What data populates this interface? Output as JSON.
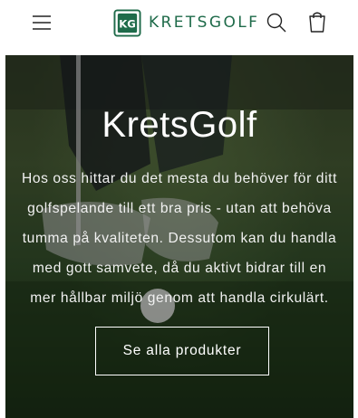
{
  "header": {
    "logo_text": "KRETSGOLF",
    "icons": [
      "menu-icon",
      "search-icon",
      "cart-icon"
    ],
    "brand_color": "#1f6b4a"
  },
  "hero": {
    "title": "KretsGolf",
    "text": "Hos oss hittar du det mesta du behöver för ditt golfspelande till ett bra pris - utan att behöva tumma på kvaliteten. Dessutom kan du handla med gott samvete, då du aktivt bidrar till en mer hållbar miljö genom att handla cirkulärt.",
    "cta_label": "Se alla produkter"
  }
}
